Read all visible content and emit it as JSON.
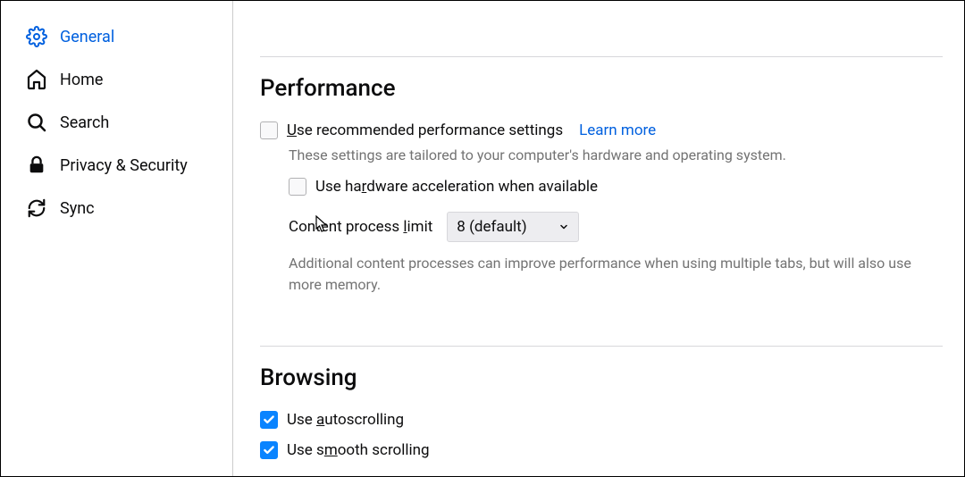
{
  "sidebar": {
    "items": [
      {
        "label": "General",
        "icon": "gear-icon",
        "active": true
      },
      {
        "label": "Home",
        "icon": "home-icon",
        "active": false
      },
      {
        "label": "Search",
        "icon": "search-icon",
        "active": false
      },
      {
        "label": "Privacy & Security",
        "icon": "lock-icon",
        "active": false
      },
      {
        "label": "Sync",
        "icon": "refresh-icon",
        "active": false
      }
    ]
  },
  "performance": {
    "title": "Performance",
    "recommended_label_pre": "U",
    "recommended_label_post": "se recommended performance settings",
    "learn_more": "Learn more",
    "desc": "These settings are tailored to your computer's hardware and operating system.",
    "hw_pre": "Use ha",
    "hw_ul": "r",
    "hw_post": "dware acceleration when available",
    "process_pre": "Content process ",
    "process_ul": "l",
    "process_post": "imit",
    "process_value": "8 (default)",
    "note": "Additional content processes can improve performance when using multiple tabs, but will also use more memory."
  },
  "browsing": {
    "title": "Browsing",
    "autoscroll_pre": "Use ",
    "autoscroll_ul": "a",
    "autoscroll_post": "utoscrolling",
    "smooth_pre": "Use s",
    "smooth_ul": "m",
    "smooth_post": "ooth scrolling"
  }
}
